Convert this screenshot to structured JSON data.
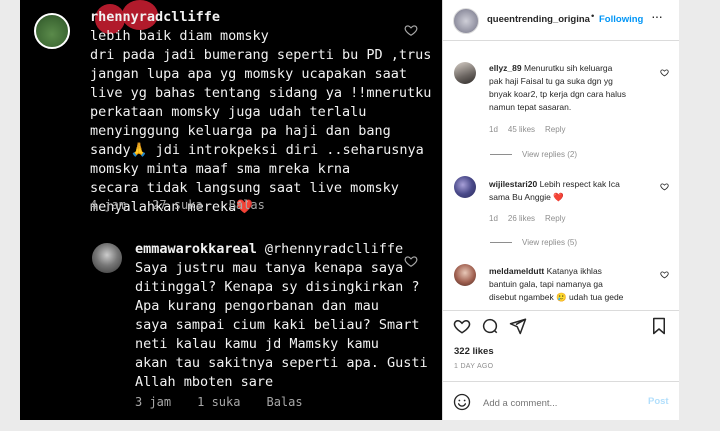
{
  "post": {
    "comments": [
      {
        "username": "rhennyradclliffe",
        "text": "lebih baik diam momsky\ndri pada jadi bumerang seperti bu PD ,trus\njangan lupa apa yg momsky ucapakan saat\nlive yg bahas tentang sidang ya !!mnerutku\nperkataan momsky juga udah terlalu\nmenyinggung keluarga pa haji dan bang\nsandy🙏 jdi introkpeksi diri ..seharusnya\nmomsky minta maaf sma mreka krna\nsecara tidak langsung saat live momsky\nmenyalahkan mereka❤️",
        "time": "4 jam",
        "likes": "27 suka",
        "reply": "Balas"
      },
      {
        "username": "emmawarokkareal",
        "text": "@rhennyradclliffe\nSaya justru mau tanya kenapa saya\nditinggal? Kenapa sy disingkirkan ?\nApa kurang pengorbanan dan mau\nsaya sampai cium kaki beliau? Smart\nneti kalau kamu jd Mamsky kamu\nakan tau sakitnya seperti apa. Gusti\nAllah mboten sare",
        "time": "3 jam",
        "likes": "1 suka",
        "reply": "Balas"
      }
    ]
  },
  "side": {
    "account": "queentrending_origina",
    "follow_label": "Following",
    "comments": [
      {
        "username": "ellyz_89",
        "text": "Menurutku sih keluarga\npak haji Faisal tu ga suka dgn yg\nbnyak koar2, tp kerja dgn cara halus\nnamun tepat sasaran.",
        "age": "1d",
        "likes": "45 likes",
        "reply": "Reply",
        "view_replies": "View replies (2)"
      },
      {
        "username": "wijilestari20",
        "text": "Lebih respect kak Ica\nsama Bu Anggie ❤️",
        "age": "1d",
        "likes": "26 likes",
        "reply": "Reply",
        "view_replies": "View replies (5)"
      },
      {
        "username": "meldameldutt",
        "text": "Katanya ikhlas\nbantuin gala, tapi namanya ga\ndisebut ngambek 🥲 udah tua gede"
      }
    ],
    "likes_count": "322 likes",
    "date": "1 DAY AGO",
    "comment_placeholder": "Add a comment...",
    "post_label": "Post"
  },
  "colors": {
    "accent": "#0095f6",
    "heart_red": "#ed4956"
  }
}
